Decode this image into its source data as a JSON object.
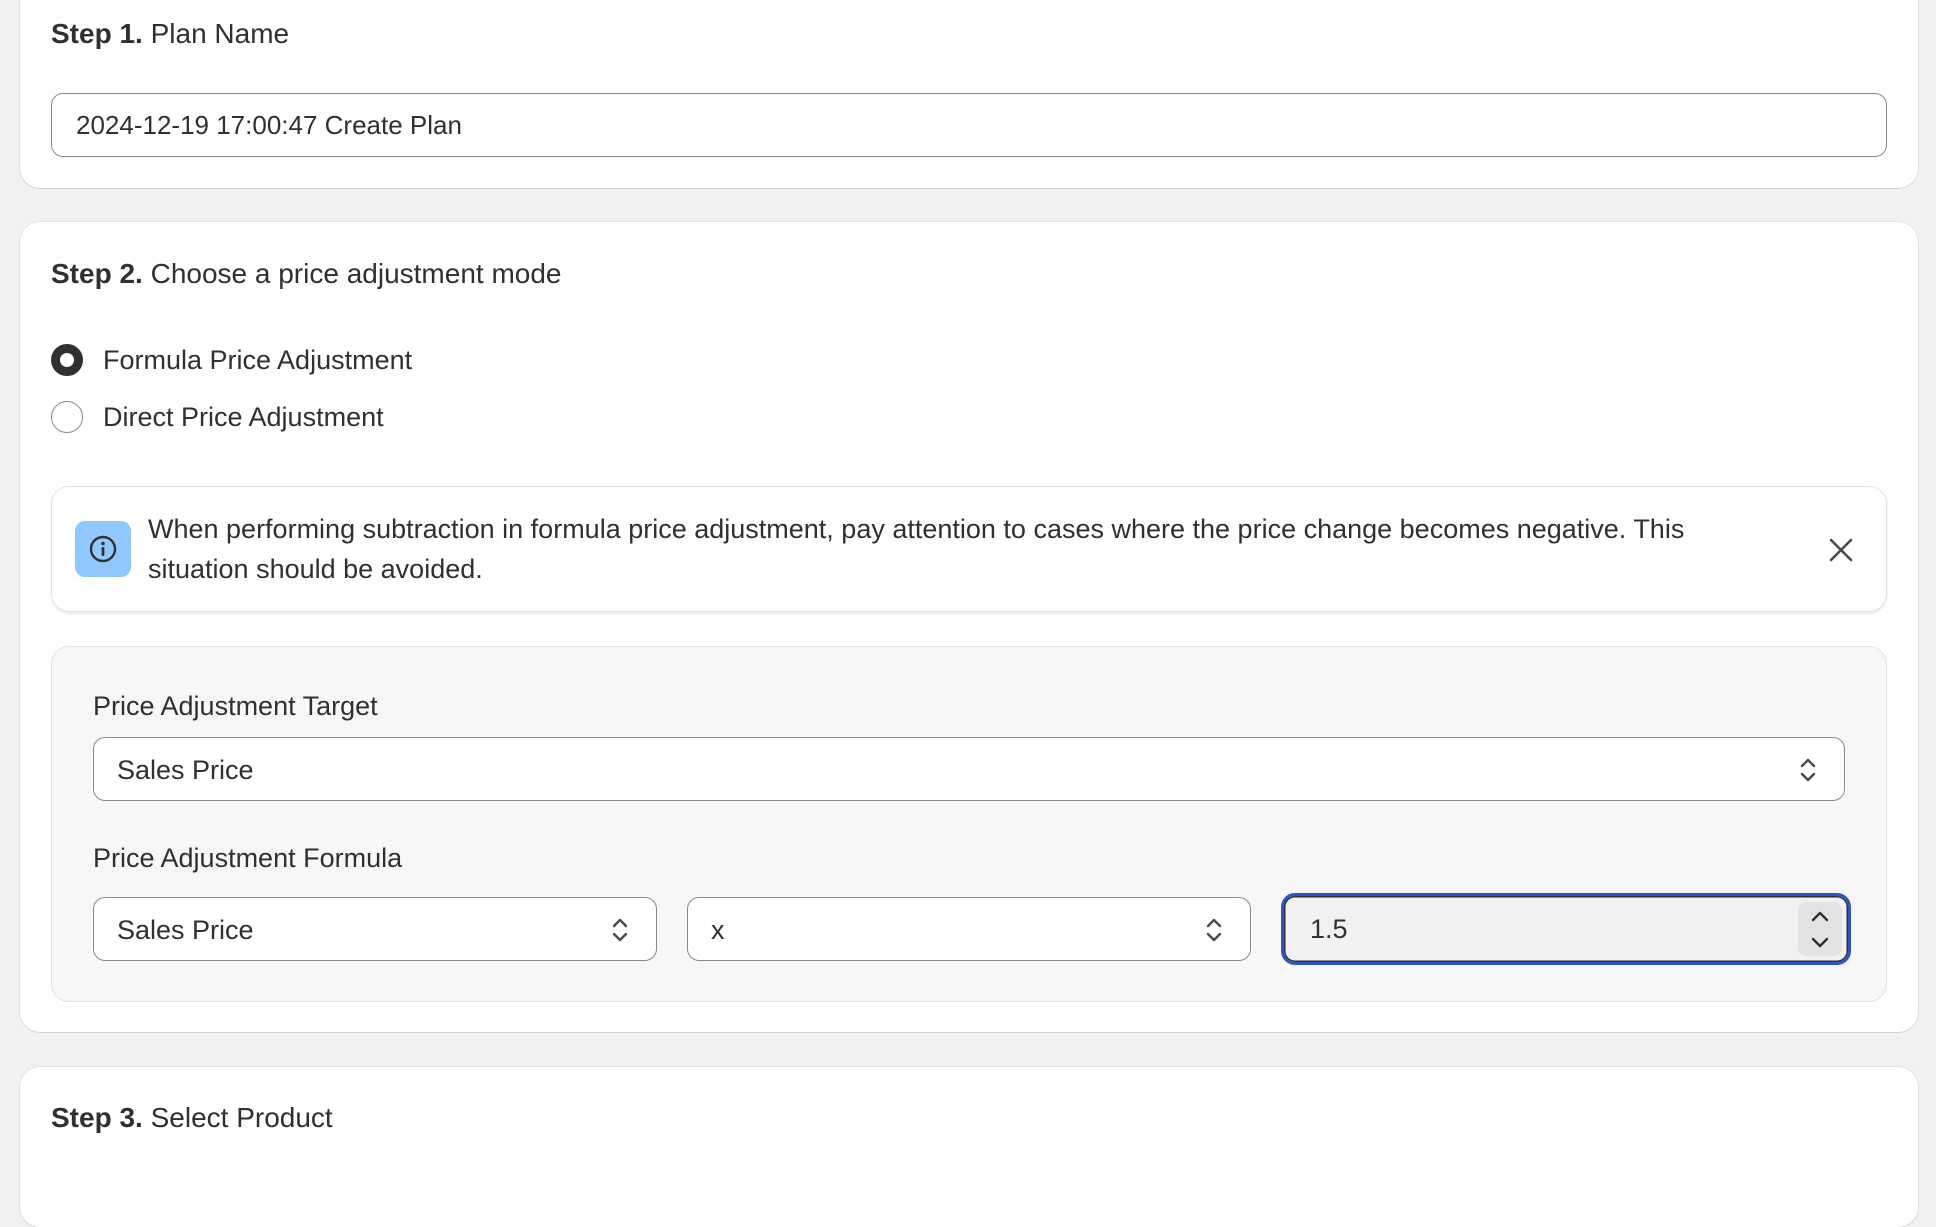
{
  "step1": {
    "step_prefix": "Step 1.",
    "step_title": "Plan Name",
    "plan_name_value": "2024-12-19 17:00:47 Create Plan"
  },
  "step2": {
    "step_prefix": "Step 2.",
    "step_title": "Choose a price adjustment mode",
    "modes": [
      {
        "label": "Formula Price Adjustment",
        "checked": true
      },
      {
        "label": "Direct Price Adjustment",
        "checked": false
      }
    ],
    "banner": {
      "icon": "info-icon",
      "text": "When performing subtraction in formula price adjustment, pay attention to cases where the price change becomes negative. This situation should be avoided.",
      "close_icon": "close-icon"
    },
    "target": {
      "label": "Price Adjustment Target",
      "selected": "Sales Price"
    },
    "formula": {
      "label": "Price Adjustment Formula",
      "field_selected": "Sales Price",
      "operator_selected": "x",
      "value": "1.5"
    }
  },
  "step3": {
    "step_prefix": "Step 3.",
    "step_title": "Select Product"
  },
  "colors": {
    "page_bg": "#f1f1f1",
    "focus_ring": "#2c55c9",
    "info_bg": "#91c9ff"
  }
}
